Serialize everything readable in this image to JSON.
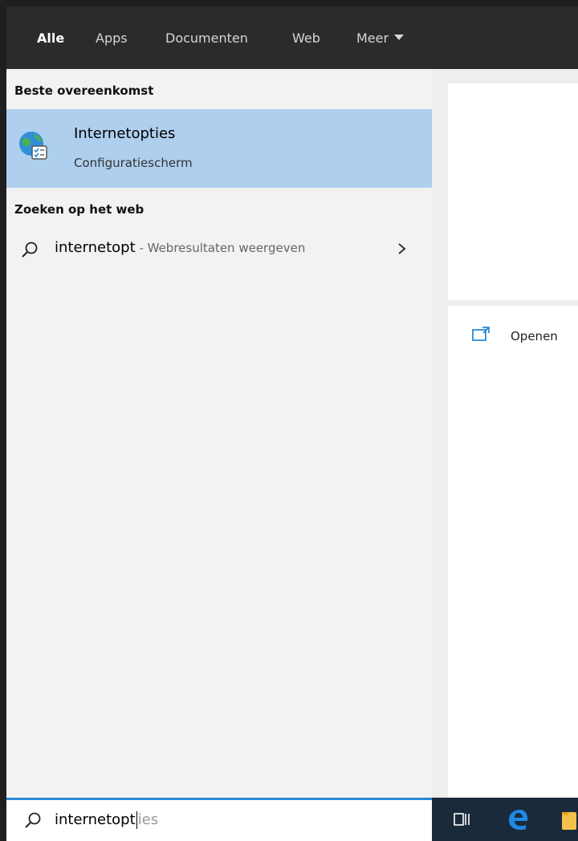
{
  "tabs": [
    {
      "label": "Alle",
      "active": true
    },
    {
      "label": "Apps"
    },
    {
      "label": "Documenten"
    },
    {
      "label": "Web"
    },
    {
      "label": "Meer"
    }
  ],
  "results": {
    "best_match_title": "Beste overeenkomst",
    "best_match": {
      "title": "Internetopties",
      "subtitle": "Configuratiescherm",
      "icon": "internet-options-icon"
    },
    "web_section_title": "Zoeken op het web",
    "web_result": {
      "query": "internetopt",
      "suffix": " - Webresultaten weergeven"
    }
  },
  "details": {
    "open_label": "Openen"
  },
  "search": {
    "typed": "internetopt",
    "suggestion": "ies"
  },
  "taskbar": {
    "icons": [
      "task-view-icon",
      "edge-icon",
      "file-explorer-icon"
    ]
  },
  "colors": {
    "accent": "#2a8ad8",
    "selected": "#aecfee",
    "topbar": "#2b2b2b"
  }
}
